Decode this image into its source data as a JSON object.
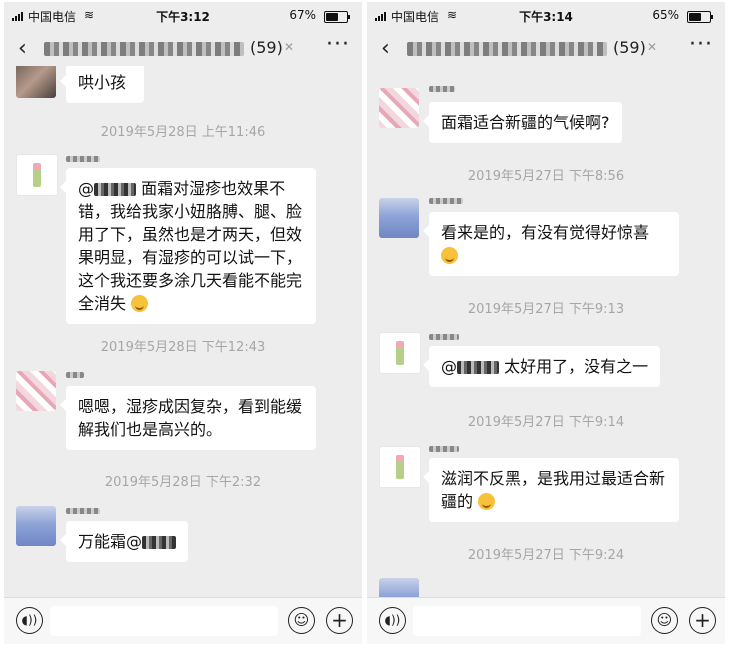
{
  "left": {
    "status": {
      "carrier": "中国电信",
      "time": "下午3:12",
      "battery": "67%",
      "battery_level": 0.67
    },
    "nav": {
      "back_icon": "‹",
      "member_count": "(59)",
      "more_icon": "···"
    },
    "partial_message": "哄小孩",
    "stamps": [
      "2019年5月28日 上午11:46",
      "2019年5月28日 下午12:43",
      "2019年5月28日 下午2:32"
    ],
    "messages": [
      {
        "prefix": "@",
        "text": " 面霜对湿疹也效果不错，我给我家小妞胳膊、腿、脸用了下，虽然也是才两天，但效果明显，有湿疹的可以试一下，这个我还要多涂几天看能不能完全消失"
      },
      {
        "text": "嗯嗯，湿疹成因复杂，看到能缓解我们也是高兴的。"
      },
      {
        "text": "万能霜@"
      }
    ]
  },
  "right": {
    "status": {
      "carrier": "中国电信",
      "time": "下午3:14",
      "battery": "65%",
      "battery_level": 0.65
    },
    "nav": {
      "back_icon": "‹",
      "member_count": "(59)",
      "more_icon": "···"
    },
    "stamps": [
      "2019年5月27日 下午8:56",
      "2019年5月27日 下午9:13",
      "2019年5月27日 下午9:14",
      "2019年5月27日 下午9:24"
    ],
    "messages": [
      {
        "text": "面霜适合新疆的气候啊?"
      },
      {
        "text": "看来是的，有没有觉得好惊喜"
      },
      {
        "prefix": "@",
        "text": " 太好用了，没有之一"
      },
      {
        "text": "滋润不反黑，是我用过最适合新疆的"
      }
    ]
  }
}
